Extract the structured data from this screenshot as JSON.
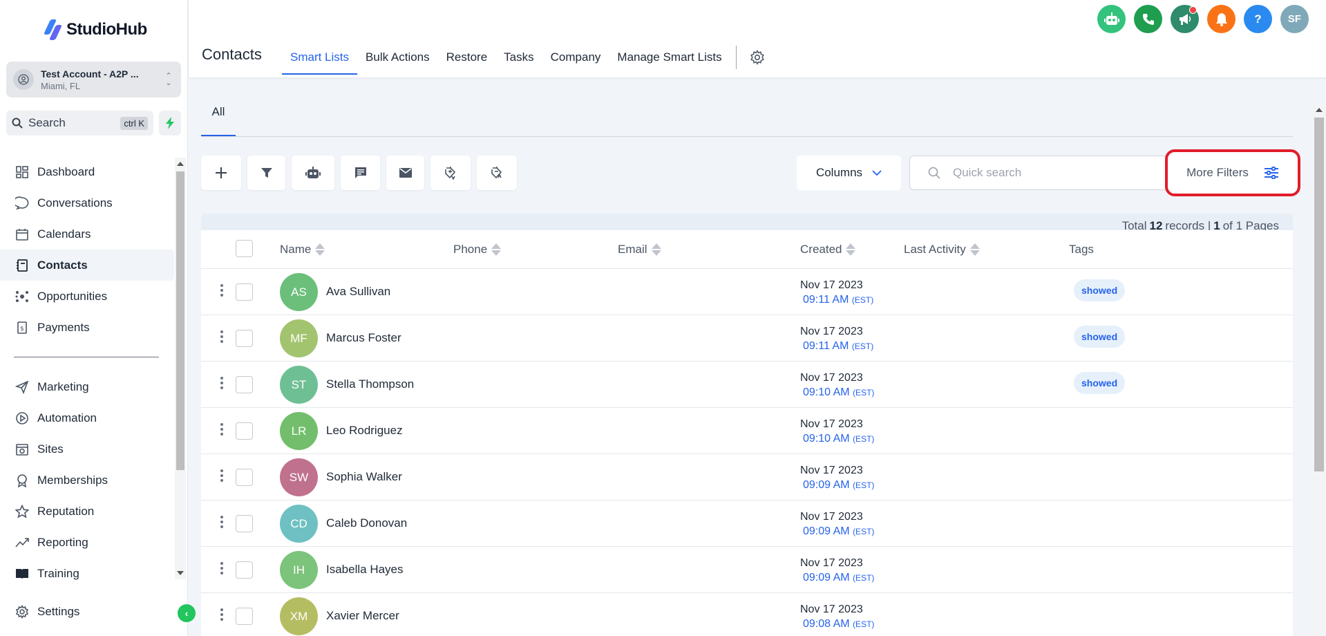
{
  "brand": {
    "name": "StudioHub"
  },
  "account": {
    "name": "Test Account - A2P ...",
    "location": "Miami, FL"
  },
  "search": {
    "label": "Search",
    "shortcut": "ctrl K"
  },
  "sidebar": {
    "items": [
      {
        "label": "Dashboard",
        "icon": "dashboard-icon"
      },
      {
        "label": "Conversations",
        "icon": "chat-icon"
      },
      {
        "label": "Calendars",
        "icon": "calendar-icon"
      },
      {
        "label": "Contacts",
        "icon": "contacts-icon",
        "active": true
      },
      {
        "label": "Opportunities",
        "icon": "opportunities-icon"
      },
      {
        "label": "Payments",
        "icon": "payments-icon"
      }
    ],
    "items2": [
      {
        "label": "Marketing",
        "icon": "send-icon"
      },
      {
        "label": "Automation",
        "icon": "automation-icon"
      },
      {
        "label": "Sites",
        "icon": "sites-icon"
      },
      {
        "label": "Memberships",
        "icon": "membership-icon"
      },
      {
        "label": "Reputation",
        "icon": "star-icon"
      },
      {
        "label": "Reporting",
        "icon": "chart-icon"
      },
      {
        "label": "Training",
        "icon": "book-icon"
      }
    ],
    "settings": "Settings"
  },
  "header": {
    "title": "Contacts",
    "tabs": [
      "Smart Lists",
      "Bulk Actions",
      "Restore",
      "Tasks",
      "Company",
      "Manage Smart Lists"
    ],
    "active_tab": "Smart Lists",
    "avatar_initials": "SF"
  },
  "subtabs": {
    "all": "All"
  },
  "toolbar": {
    "columns_label": "Columns",
    "quick_search_placeholder": "Quick search",
    "more_filters_label": "More Filters"
  },
  "records": {
    "prefix": "Total",
    "total": "12",
    "middle": "records |",
    "page": "1",
    "suffix": "of 1 Pages"
  },
  "table": {
    "headers": {
      "name": "Name",
      "phone": "Phone",
      "email": "Email",
      "created": "Created",
      "last_activity": "Last Activity",
      "tags": "Tags"
    },
    "rows": [
      {
        "initials": "AS",
        "name": "Ava Sullivan",
        "date": "Nov 17 2023",
        "time": "09:11 AM",
        "tz": "(EST)",
        "tag": "showed",
        "color": "#6cbf7a"
      },
      {
        "initials": "MF",
        "name": "Marcus Foster",
        "date": "Nov 17 2023",
        "time": "09:11 AM",
        "tz": "(EST)",
        "tag": "showed",
        "color": "#a3c46f"
      },
      {
        "initials": "ST",
        "name": "Stella Thompson",
        "date": "Nov 17 2023",
        "time": "09:10 AM",
        "tz": "(EST)",
        "tag": "showed",
        "color": "#6fbf95"
      },
      {
        "initials": "LR",
        "name": "Leo Rodriguez",
        "date": "Nov 17 2023",
        "time": "09:10 AM",
        "tz": "(EST)",
        "tag": "",
        "color": "#72be6c"
      },
      {
        "initials": "SW",
        "name": "Sophia Walker",
        "date": "Nov 17 2023",
        "time": "09:09 AM",
        "tz": "(EST)",
        "tag": "",
        "color": "#c0718e"
      },
      {
        "initials": "CD",
        "name": "Caleb Donovan",
        "date": "Nov 17 2023",
        "time": "09:09 AM",
        "tz": "(EST)",
        "tag": "",
        "color": "#6ec0c2"
      },
      {
        "initials": "IH",
        "name": "Isabella Hayes",
        "date": "Nov 17 2023",
        "time": "09:09 AM",
        "tz": "(EST)",
        "tag": "",
        "color": "#7cc37c"
      },
      {
        "initials": "XM",
        "name": "Xavier Mercer",
        "date": "Nov 17 2023",
        "time": "09:08 AM",
        "tz": "(EST)",
        "tag": "",
        "color": "#b5bd62"
      }
    ]
  },
  "colors": {
    "accent": "#2563eb",
    "highlight": "#e11d2a",
    "green": "#22c55e"
  }
}
